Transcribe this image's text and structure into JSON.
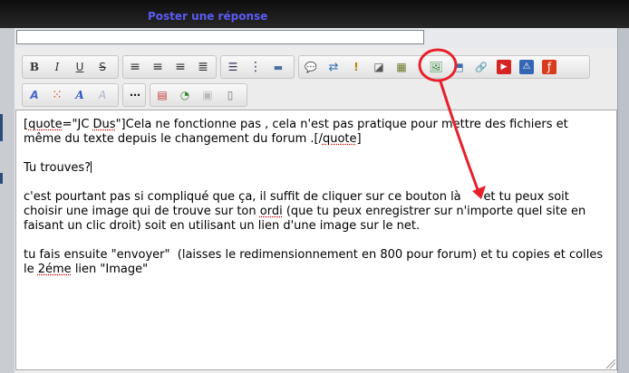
{
  "window": {
    "title": "Poster une réponse"
  },
  "subject": {
    "value": ""
  },
  "toolbar": {
    "row1": [
      {
        "name": "bold-button",
        "glyph": "B",
        "style": "font-weight:bold;font-family:'DejaVu Serif',serif;color:#333"
      },
      {
        "name": "italic-button",
        "glyph": "I",
        "style": "font-style:italic;font-family:'DejaVu Serif',serif;color:#333"
      },
      {
        "name": "underline-button",
        "glyph": "U",
        "style": "text-decoration:underline;color:#333"
      },
      {
        "name": "strikethrough-button",
        "glyph": "S",
        "style": "text-decoration:line-through;color:#333"
      },
      {
        "name": "align-left-button",
        "glyph": "≡",
        "style": "color:#333;font-size:14px"
      },
      {
        "name": "align-center-button",
        "glyph": "≡",
        "style": "color:#333;font-size:14px"
      },
      {
        "name": "align-right-button",
        "glyph": "≡",
        "style": "color:#333;font-size:14px"
      },
      {
        "name": "justify-button",
        "glyph": "≣",
        "style": "color:#333;font-size:14px"
      },
      {
        "name": "bullet-list-button",
        "glyph": "☰",
        "style": "color:#335;font-size:12px"
      },
      {
        "name": "numbered-list-button",
        "glyph": "⋮",
        "style": "color:#335;font-size:14px"
      },
      {
        "name": "horizontal-rule-button",
        "glyph": "▬",
        "style": "color:#4a6fa5;font-size:11px"
      },
      {
        "name": "quote-button",
        "glyph": "💬",
        "style": "color:#3a78c2;font-size:11px"
      },
      {
        "name": "code-button",
        "glyph": "⇄",
        "style": "color:#2f6fb3;font-size:13px"
      },
      {
        "name": "spoiler-button",
        "glyph": "!",
        "style": "color:#b08a00;font-weight:bold"
      },
      {
        "name": "hide-button",
        "glyph": "◪",
        "style": "color:#555"
      },
      {
        "name": "table-button",
        "glyph": "▦",
        "style": "color:#6a7a2a"
      },
      {
        "name": "insert-image-button",
        "glyph": "🖼",
        "style": "color:#2f8a3b;font-size:12px"
      },
      {
        "name": "upload-image-button",
        "glyph": "⬒",
        "style": "color:#3b6aa8"
      },
      {
        "name": "insert-link-button",
        "glyph": "🔗",
        "style": "color:#555;font-size:11px"
      },
      {
        "name": "youtube-button",
        "glyph": "▶",
        "style": "color:#fff;background:#d62424;border-radius:2px;font-size:9px;width:16px;height:16px;display:flex;align-items:center;justify-content:center"
      },
      {
        "name": "flash-button",
        "glyph": "⚠",
        "style": "color:#fff;background:#3466b3;border-radius:2px;font-size:10px;width:16px;height:16px;display:flex;align-items:center;justify-content:center"
      },
      {
        "name": "flash-player-button",
        "glyph": "ƒ",
        "style": "color:#fff;background:#d93a1e;border-radius:2px;font-size:12px;width:16px;height:16px;display:flex;align-items:center;justify-content:center"
      }
    ],
    "row2": [
      {
        "name": "font-size-button",
        "glyph": "A",
        "style": "color:#4466cc;font-weight:bold;font-style:italic"
      },
      {
        "name": "color-picker-button",
        "glyph": "⁙",
        "style": "color:#e24a2a;font-size:14px"
      },
      {
        "name": "font-family-button",
        "glyph": "A",
        "style": "color:#2a58c9;font-weight:bold;font-style:italic;font-family:'DejaVu Serif',serif"
      },
      {
        "name": "remove-format-button",
        "glyph": "A",
        "style": "color:#a9b3c6;font-style:italic"
      },
      {
        "name": "more-options-button",
        "glyph": "⋯",
        "style": "color:#222;font-weight:bold"
      },
      {
        "name": "date-button",
        "glyph": "▤",
        "style": "color:#c23a3a"
      },
      {
        "name": "time-button",
        "glyph": "◔",
        "style": "color:#3a8a3a"
      },
      {
        "name": "paste-button",
        "glyph": "▣",
        "style": "color:#b8b8b8"
      },
      {
        "name": "source-view-button",
        "glyph": "▯",
        "style": "color:#777"
      }
    ]
  },
  "editor": {
    "paragraphs": [
      {
        "segments": [
          {
            "text": "[",
            "squiggle": false
          },
          {
            "text": "quote",
            "squiggle": true
          },
          {
            "text": "=\"JC ",
            "squiggle": false
          },
          {
            "text": "Dus",
            "squiggle": true
          },
          {
            "text": "\"]Cela ne fonctionne pas , cela n'est pas pratique pour mettre des fichiers et même du texte depuis le changement du forum .[/",
            "squiggle": false
          },
          {
            "text": "quote",
            "squiggle": true
          },
          {
            "text": "]",
            "squiggle": false
          }
        ]
      },
      {
        "segments": [
          {
            "text": "Tu trouves?",
            "squiggle": false
          }
        ],
        "caret": true
      },
      {
        "segments": [
          {
            "text": "c'est pourtant pas si compliqué que ça, il suffit de cliquer sur ce bouton là      et tu peux soit choisir une image qui de trouve sur ton ",
            "squiggle": false
          },
          {
            "text": "ordi",
            "squiggle": true
          },
          {
            "text": " (que tu peux enregistrer sur n'importe quel site en faisant un clic droit) soit en utilisant un lien d'une image sur le net.",
            "squiggle": false
          }
        ]
      },
      {
        "segments": [
          {
            "text": "tu fais ensuite \"envoyer\"  (laisses le redimensionnement en 800 pour forum) et tu copies et colles le ",
            "squiggle": false
          },
          {
            "text": "2éme",
            "squiggle": true
          },
          {
            "text": " lien \"Image\"",
            "squiggle": false
          }
        ]
      }
    ]
  },
  "annotation": {
    "color": "#e8202a"
  }
}
